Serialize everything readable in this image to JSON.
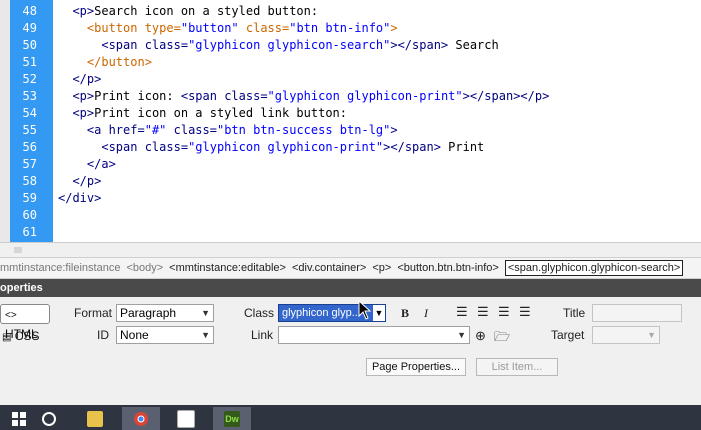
{
  "editor": {
    "line_numbers": [
      "48",
      "49",
      "50",
      "51",
      "52",
      "53",
      "54",
      "55",
      "56",
      "57",
      "58",
      "59",
      "60",
      "61"
    ],
    "lines": [
      [
        [
          "txt",
          "  "
        ],
        [
          "tag",
          "<p>"
        ],
        [
          "txt",
          "Search icon on a styled button:"
        ]
      ],
      [
        [
          "txt",
          "    "
        ],
        [
          "btntag",
          "<button"
        ],
        [
          "attr",
          " type="
        ],
        [
          "str",
          "\"button\""
        ],
        [
          "attr",
          " class="
        ],
        [
          "str",
          "\"btn btn-info\""
        ],
        [
          "btntag",
          ">"
        ]
      ],
      [
        [
          "txt",
          "      "
        ],
        [
          "tag",
          "<span"
        ],
        [
          "spanattr",
          " class="
        ],
        [
          "str",
          "\"glyphicon glyphicon-search\""
        ],
        [
          "tag",
          "></span>"
        ],
        [
          "txt",
          " Search"
        ]
      ],
      [
        [
          "txt",
          "    "
        ],
        [
          "btntag",
          "</button>"
        ]
      ],
      [
        [
          "txt",
          "  "
        ],
        [
          "tag",
          "</p>"
        ]
      ],
      [
        [
          "txt",
          "  "
        ],
        [
          "tag",
          "<p>"
        ],
        [
          "txt",
          "Print icon: "
        ],
        [
          "tag",
          "<span"
        ],
        [
          "spanattr",
          " class="
        ],
        [
          "str",
          "\"glyphicon glyphicon-print\""
        ],
        [
          "tag",
          "></span></p>"
        ]
      ],
      [
        [
          "txt",
          "  "
        ],
        [
          "tag",
          "<p>"
        ],
        [
          "txt",
          "Print icon on a styled link button:"
        ]
      ],
      [
        [
          "txt",
          "    "
        ],
        [
          "tag",
          "<a"
        ],
        [
          "spanattr",
          " href="
        ],
        [
          "str",
          "\"#\""
        ],
        [
          "spanattr",
          " class="
        ],
        [
          "str",
          "\"btn btn-success btn-lg\""
        ],
        [
          "tag",
          ">"
        ]
      ],
      [
        [
          "txt",
          "      "
        ],
        [
          "tag",
          "<span"
        ],
        [
          "spanattr",
          " class="
        ],
        [
          "str",
          "\"glyphicon glyphicon-print\""
        ],
        [
          "tag",
          "></span>"
        ],
        [
          "txt",
          " Print"
        ]
      ],
      [
        [
          "txt",
          "    "
        ],
        [
          "tag",
          "</a>"
        ]
      ],
      [
        [
          "txt",
          "  "
        ],
        [
          "tag",
          "</p>"
        ]
      ],
      [
        [
          "tag",
          "</div>"
        ]
      ],
      [],
      []
    ]
  },
  "tag_selector": [
    {
      "text": "mmtinstance:fileinstance",
      "dim": true
    },
    {
      "text": "<body>",
      "dim": true
    },
    {
      "text": "<mmtinstance:editable>",
      "dim": false
    },
    {
      "text": "<div.container>",
      "dim": false
    },
    {
      "text": "<p>",
      "dim": false
    },
    {
      "text": "<button.btn.btn-info>",
      "dim": false
    },
    {
      "text": "<span.glyphicon.glyphicon-search>",
      "sel": true
    }
  ],
  "properties": {
    "header": "operties",
    "html_mode": "HTML",
    "css_mode": "CSS",
    "format_label": "Format",
    "format_value": "Paragraph",
    "id_label": "ID",
    "id_value": "None",
    "class_label": "Class",
    "class_value": "glyphicon glyp...",
    "link_label": "Link",
    "link_value": "",
    "bold": "B",
    "italic": "I",
    "title_label": "Title",
    "title_value": "",
    "target_label": "Target",
    "target_value": "",
    "page_properties": "Page Properties...",
    "list_item": "List Item..."
  },
  "taskbar": {
    "items": [
      "start",
      "cortana",
      "file-explorer",
      "chrome",
      "calculator",
      "dreamweaver"
    ],
    "dreamweaver_label": "Dw"
  }
}
